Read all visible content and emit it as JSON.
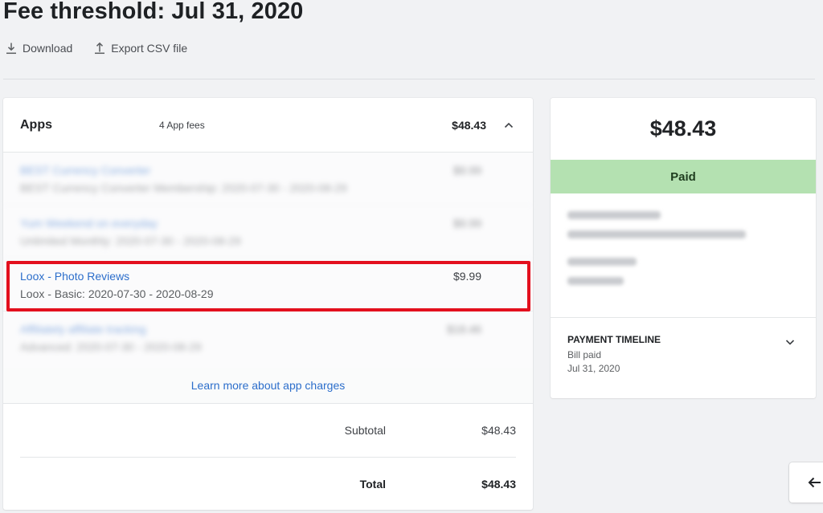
{
  "page": {
    "title": "Fee threshold: Jul 31, 2020"
  },
  "actions": {
    "download_label": "Download",
    "export_label": "Export CSV file",
    "download_icon": "download-icon",
    "export_icon": "upload-icon"
  },
  "apps": {
    "title": "Apps",
    "count_label": "4 App fees",
    "total": "$48.43",
    "collapse_icon": "chevron-up-icon",
    "fees": [
      {
        "name": "BEST Currency Converter",
        "description": "BEST Currency Converter Membership: 2020-07-30 - 2020-08-29",
        "amount": "$9.99",
        "blurred": true
      },
      {
        "name": "Yum Weekend on everyday",
        "description": "Unlimited Monthly: 2020-07-30 - 2020-08-29",
        "amount": "$9.99",
        "blurred": true
      },
      {
        "name": "Loox - Photo Reviews",
        "description": "Loox - Basic: 2020-07-30 - 2020-08-29",
        "amount": "$9.99",
        "blurred": false
      },
      {
        "name": "Affiliately affiliate tracking",
        "description": "Advanced: 2020-07-30 - 2020-08-29",
        "amount": "$18.46",
        "blurred": true
      }
    ],
    "learn_more": "Learn more about app charges",
    "subtotal_label": "Subtotal",
    "subtotal_value": "$48.43",
    "total_label": "Total",
    "total_value": "$48.43"
  },
  "bill": {
    "amount": "$48.43",
    "status": "Paid",
    "status_color": "#b4e1b1",
    "timeline_title": "PAYMENT TIMELINE",
    "timeline_event": "Bill paid",
    "timeline_date": "Jul 31, 2020",
    "expand_icon": "chevron-down-icon"
  },
  "side_button": {
    "icon": "arrow-left-icon"
  },
  "colors": {
    "link": "#2c6ecb",
    "highlight": "#e3101e",
    "background": "#f1f2f4"
  }
}
